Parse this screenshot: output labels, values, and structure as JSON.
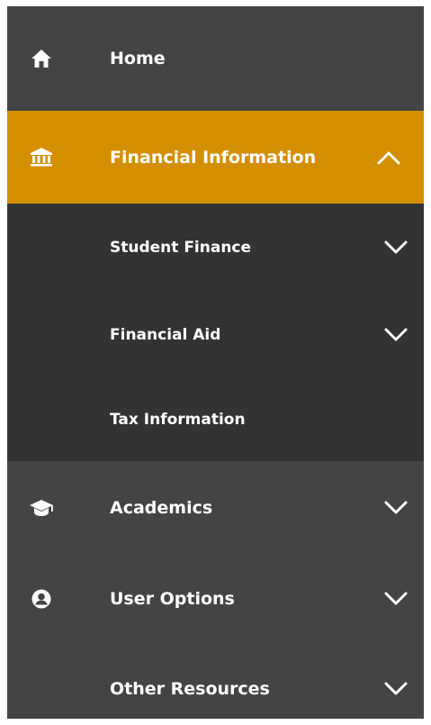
{
  "nav": {
    "home": {
      "label": "Home",
      "icon": "home-icon"
    },
    "financial_information": {
      "label": "Financial Information",
      "icon": "bank-icon",
      "expanded": true,
      "accent_color": "#d48f00",
      "children": [
        {
          "label": "Student Finance"
        },
        {
          "label": "Financial Aid"
        },
        {
          "label": "Tax Information"
        }
      ]
    },
    "academics": {
      "label": "Academics",
      "icon": "graduation-cap-icon"
    },
    "user_options": {
      "label": "User Options",
      "icon": "user-avatar-icon"
    },
    "other_resources": {
      "label": "Other Resources"
    }
  },
  "colors": {
    "nav_background": "#444444",
    "submenu_background": "#333333",
    "active_background": "#d48f00",
    "text": "#ffffff"
  }
}
